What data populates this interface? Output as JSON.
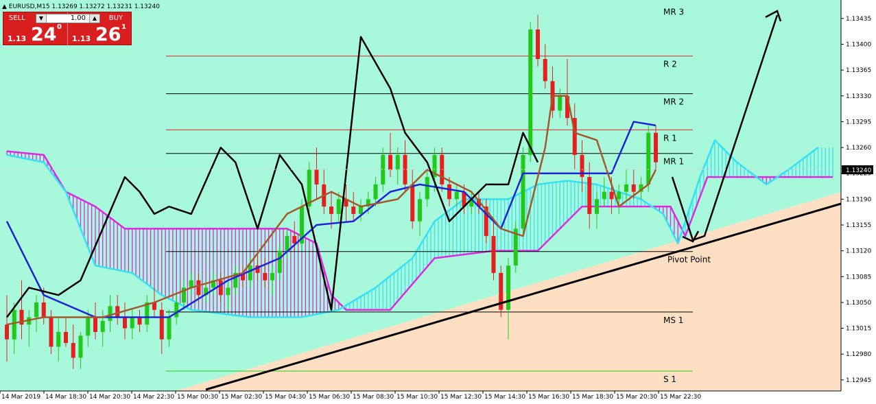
{
  "header": {
    "symbol_info": "▲ EURUSD,M15  1.13269 1.13272 1.13231 1.13240"
  },
  "trade_panel": {
    "sell_label": "SELL",
    "buy_label": "BUY",
    "lot_value": "1.00",
    "sell_price_prefix": "1.13",
    "sell_price_big": "24",
    "sell_price_sup": "0",
    "buy_price_prefix": "1.13",
    "buy_price_big": "26",
    "buy_price_sup": "1"
  },
  "colors": {
    "background_upper": "#a8f9dc",
    "background_lower": "#fde0c3",
    "bull_candle": "#22c81a",
    "bear_candle": "#e61e1e",
    "tenkan": "#1f22d8",
    "kijun": "#a5572c",
    "chikou": "#000000",
    "span_a": "#e026e0",
    "span_b": "#35e0f5",
    "pivot_red": "#e61e1e",
    "pivot_black": "#000000",
    "pivot_green": "#22c81a"
  },
  "chart_data": {
    "type": "candlestick",
    "symbol": "EURUSD",
    "timeframe": "M15",
    "ylim": [
      1.1293,
      1.1346
    ],
    "y_ticks": [
      "1.13435",
      "1.13400",
      "1.13365",
      "1.13330",
      "1.13295",
      "1.13260",
      "1.13225",
      "1.13190",
      "1.13155",
      "1.13120",
      "1.13085",
      "1.13050",
      "1.13015",
      "1.12980",
      "1.12945"
    ],
    "x_ticks": [
      "14 Mar 2019",
      "14 Mar 18:30",
      "14 Mar 20:30",
      "14 Mar 22:30",
      "15 Mar 00:30",
      "15 Mar 02:30",
      "15 Mar 04:30",
      "15 Mar 06:30",
      "15 Mar 08:30",
      "15 Mar 10:30",
      "15 Mar 12:30",
      "15 Mar 14:30",
      "15 Mar 16:30",
      "15 Mar 18:30",
      "15 Mar 20:30",
      "15 Mar 22:30"
    ],
    "current_price": "1.13240",
    "levels": [
      {
        "label": "MR 3",
        "value": 1.13455,
        "color": "none"
      },
      {
        "label": "R 2",
        "value": 1.13384,
        "color": "red"
      },
      {
        "label": "MR 2",
        "value": 1.13333,
        "color": "black"
      },
      {
        "label": "R 1",
        "value": 1.13284,
        "color": "red"
      },
      {
        "label": "MR 1",
        "value": 1.13252,
        "color": "black"
      },
      {
        "label": "Pivot Point",
        "value": 1.13119,
        "color": "black"
      },
      {
        "label": "MS 1",
        "value": 1.13037,
        "color": "black"
      },
      {
        "label": "S 1",
        "value": 1.12957,
        "color": "green"
      }
    ],
    "candles": [
      {
        "o": 1.1302,
        "h": 1.1306,
        "l": 1.1297,
        "c": 1.13
      },
      {
        "o": 1.13,
        "h": 1.1305,
        "l": 1.1298,
        "c": 1.1304
      },
      {
        "o": 1.1304,
        "h": 1.1308,
        "l": 1.13,
        "c": 1.1302
      },
      {
        "o": 1.1302,
        "h": 1.1304,
        "l": 1.1299,
        "c": 1.1303
      },
      {
        "o": 1.1303,
        "h": 1.1306,
        "l": 1.1301,
        "c": 1.1305
      },
      {
        "o": 1.1305,
        "h": 1.1307,
        "l": 1.1302,
        "c": 1.1303
      },
      {
        "o": 1.1303,
        "h": 1.1304,
        "l": 1.1298,
        "c": 1.1299
      },
      {
        "o": 1.1299,
        "h": 1.1303,
        "l": 1.1297,
        "c": 1.1301
      },
      {
        "o": 1.1301,
        "h": 1.1303,
        "l": 1.1299,
        "c": 1.12995
      },
      {
        "o": 1.12995,
        "h": 1.1302,
        "l": 1.1296,
        "c": 1.12975
      },
      {
        "o": 1.12975,
        "h": 1.1301,
        "l": 1.1296,
        "c": 1.13005
      },
      {
        "o": 1.13005,
        "h": 1.1304,
        "l": 1.1299,
        "c": 1.1303
      },
      {
        "o": 1.1303,
        "h": 1.1305,
        "l": 1.13,
        "c": 1.1301
      },
      {
        "o": 1.1301,
        "h": 1.1304,
        "l": 1.1299,
        "c": 1.13025
      },
      {
        "o": 1.13025,
        "h": 1.1306,
        "l": 1.1301,
        "c": 1.13045
      },
      {
        "o": 1.13045,
        "h": 1.1306,
        "l": 1.1302,
        "c": 1.1303
      },
      {
        "o": 1.1303,
        "h": 1.1305,
        "l": 1.13,
        "c": 1.13015
      },
      {
        "o": 1.13015,
        "h": 1.1304,
        "l": 1.13,
        "c": 1.1303
      },
      {
        "o": 1.1303,
        "h": 1.1304,
        "l": 1.1301,
        "c": 1.1302
      },
      {
        "o": 1.1302,
        "h": 1.1306,
        "l": 1.1301,
        "c": 1.1305
      },
      {
        "o": 1.1305,
        "h": 1.1307,
        "l": 1.1303,
        "c": 1.1304
      },
      {
        "o": 1.1304,
        "h": 1.1305,
        "l": 1.1298,
        "c": 1.13
      },
      {
        "o": 1.13,
        "h": 1.1304,
        "l": 1.1299,
        "c": 1.1303
      },
      {
        "o": 1.1303,
        "h": 1.1306,
        "l": 1.1302,
        "c": 1.1305
      },
      {
        "o": 1.1305,
        "h": 1.1308,
        "l": 1.1304,
        "c": 1.1307
      },
      {
        "o": 1.1307,
        "h": 1.1309,
        "l": 1.1306,
        "c": 1.1308
      },
      {
        "o": 1.1308,
        "h": 1.1309,
        "l": 1.1305,
        "c": 1.1306
      },
      {
        "o": 1.1306,
        "h": 1.1308,
        "l": 1.1305,
        "c": 1.1307
      },
      {
        "o": 1.1307,
        "h": 1.1309,
        "l": 1.1306,
        "c": 1.1308
      },
      {
        "o": 1.1308,
        "h": 1.1309,
        "l": 1.1305,
        "c": 1.1306
      },
      {
        "o": 1.1306,
        "h": 1.1308,
        "l": 1.1304,
        "c": 1.1307
      },
      {
        "o": 1.1307,
        "h": 1.131,
        "l": 1.1306,
        "c": 1.1309
      },
      {
        "o": 1.1309,
        "h": 1.131,
        "l": 1.1307,
        "c": 1.1308
      },
      {
        "o": 1.1308,
        "h": 1.1311,
        "l": 1.1307,
        "c": 1.131
      },
      {
        "o": 1.131,
        "h": 1.1312,
        "l": 1.1308,
        "c": 1.1309
      },
      {
        "o": 1.1309,
        "h": 1.1311,
        "l": 1.1307,
        "c": 1.1308
      },
      {
        "o": 1.1308,
        "h": 1.131,
        "l": 1.1306,
        "c": 1.1309
      },
      {
        "o": 1.1309,
        "h": 1.1313,
        "l": 1.1308,
        "c": 1.1312
      },
      {
        "o": 1.1312,
        "h": 1.1315,
        "l": 1.1311,
        "c": 1.1314
      },
      {
        "o": 1.1314,
        "h": 1.1316,
        "l": 1.1312,
        "c": 1.1313
      },
      {
        "o": 1.1313,
        "h": 1.1319,
        "l": 1.1312,
        "c": 1.1318
      },
      {
        "o": 1.1318,
        "h": 1.1324,
        "l": 1.1317,
        "c": 1.1323
      },
      {
        "o": 1.1323,
        "h": 1.1326,
        "l": 1.1319,
        "c": 1.1321
      },
      {
        "o": 1.1321,
        "h": 1.1323,
        "l": 1.1317,
        "c": 1.1318
      },
      {
        "o": 1.1318,
        "h": 1.132,
        "l": 1.1315,
        "c": 1.1317
      },
      {
        "o": 1.1317,
        "h": 1.132,
        "l": 1.1316,
        "c": 1.1319
      },
      {
        "o": 1.1319,
        "h": 1.1321,
        "l": 1.1316,
        "c": 1.1318
      },
      {
        "o": 1.1318,
        "h": 1.132,
        "l": 1.1316,
        "c": 1.1317
      },
      {
        "o": 1.1317,
        "h": 1.1319,
        "l": 1.1316,
        "c": 1.1318
      },
      {
        "o": 1.1318,
        "h": 1.132,
        "l": 1.1317,
        "c": 1.1319
      },
      {
        "o": 1.1319,
        "h": 1.1322,
        "l": 1.1318,
        "c": 1.1321
      },
      {
        "o": 1.1321,
        "h": 1.1326,
        "l": 1.132,
        "c": 1.1325
      },
      {
        "o": 1.1325,
        "h": 1.1328,
        "l": 1.1322,
        "c": 1.1323
      },
      {
        "o": 1.1323,
        "h": 1.1326,
        "l": 1.1321,
        "c": 1.1325
      },
      {
        "o": 1.1325,
        "h": 1.1327,
        "l": 1.132,
        "c": 1.1321
      },
      {
        "o": 1.1321,
        "h": 1.1323,
        "l": 1.1315,
        "c": 1.1316
      },
      {
        "o": 1.1316,
        "h": 1.132,
        "l": 1.1314,
        "c": 1.1319
      },
      {
        "o": 1.1319,
        "h": 1.1323,
        "l": 1.1318,
        "c": 1.1322
      },
      {
        "o": 1.1322,
        "h": 1.1326,
        "l": 1.132,
        "c": 1.1325
      },
      {
        "o": 1.1325,
        "h": 1.1326,
        "l": 1.132,
        "c": 1.1321
      },
      {
        "o": 1.1321,
        "h": 1.1322,
        "l": 1.1318,
        "c": 1.1319
      },
      {
        "o": 1.1319,
        "h": 1.1321,
        "l": 1.1318,
        "c": 1.132
      },
      {
        "o": 1.132,
        "h": 1.1321,
        "l": 1.1317,
        "c": 1.1318
      },
      {
        "o": 1.1318,
        "h": 1.132,
        "l": 1.1317,
        "c": 1.1319
      },
      {
        "o": 1.1319,
        "h": 1.132,
        "l": 1.1317,
        "c": 1.1318
      },
      {
        "o": 1.1318,
        "h": 1.1319,
        "l": 1.1313,
        "c": 1.1314
      },
      {
        "o": 1.1314,
        "h": 1.1316,
        "l": 1.1308,
        "c": 1.1309
      },
      {
        "o": 1.1309,
        "h": 1.131,
        "l": 1.1303,
        "c": 1.1304
      },
      {
        "o": 1.1304,
        "h": 1.1311,
        "l": 1.13,
        "c": 1.131
      },
      {
        "o": 1.131,
        "h": 1.1316,
        "l": 1.1309,
        "c": 1.1315
      },
      {
        "o": 1.1315,
        "h": 1.1326,
        "l": 1.1314,
        "c": 1.1325
      },
      {
        "o": 1.1325,
        "h": 1.1343,
        "l": 1.1324,
        "c": 1.1342
      },
      {
        "o": 1.1342,
        "h": 1.1344,
        "l": 1.1337,
        "c": 1.1338
      },
      {
        "o": 1.1338,
        "h": 1.134,
        "l": 1.1334,
        "c": 1.1335
      },
      {
        "o": 1.1335,
        "h": 1.1337,
        "l": 1.133,
        "c": 1.1331
      },
      {
        "o": 1.1331,
        "h": 1.1334,
        "l": 1.133,
        "c": 1.1333
      },
      {
        "o": 1.1333,
        "h": 1.1338,
        "l": 1.1329,
        "c": 1.133
      },
      {
        "o": 1.133,
        "h": 1.1332,
        "l": 1.1323,
        "c": 1.1325
      },
      {
        "o": 1.1325,
        "h": 1.1327,
        "l": 1.132,
        "c": 1.1322
      },
      {
        "o": 1.1322,
        "h": 1.1324,
        "l": 1.1315,
        "c": 1.1317
      },
      {
        "o": 1.1317,
        "h": 1.132,
        "l": 1.1315,
        "c": 1.1319
      },
      {
        "o": 1.1319,
        "h": 1.1322,
        "l": 1.1318,
        "c": 1.132
      },
      {
        "o": 1.132,
        "h": 1.1322,
        "l": 1.1317,
        "c": 1.1319
      },
      {
        "o": 1.1319,
        "h": 1.1321,
        "l": 1.1317,
        "c": 1.132
      },
      {
        "o": 1.132,
        "h": 1.1323,
        "l": 1.1319,
        "c": 1.1321
      },
      {
        "o": 1.1321,
        "h": 1.1323,
        "l": 1.1319,
        "c": 1.132
      },
      {
        "o": 1.132,
        "h": 1.1322,
        "l": 1.1319,
        "c": 1.1321
      },
      {
        "o": 1.1321,
        "h": 1.1329,
        "l": 1.132,
        "c": 1.1328
      },
      {
        "o": 1.1328,
        "h": 1.1329,
        "l": 1.1323,
        "c": 1.1324
      }
    ],
    "tenkan": [
      [
        0,
        1.1316
      ],
      [
        5,
        1.1306
      ],
      [
        12,
        1.1303
      ],
      [
        22,
        1.1303
      ],
      [
        30,
        1.1308
      ],
      [
        37,
        1.1311
      ],
      [
        42,
        1.13155
      ],
      [
        47,
        1.1316
      ],
      [
        52,
        1.132
      ],
      [
        56,
        1.1321
      ],
      [
        62,
        1.132
      ],
      [
        67,
        1.1315
      ],
      [
        70,
        1.13225
      ],
      [
        82,
        1.13225
      ],
      [
        85,
        1.13295
      ],
      [
        88,
        1.1329
      ]
    ],
    "kijun": [
      [
        0,
        1.1302
      ],
      [
        5,
        1.1303
      ],
      [
        13,
        1.1303
      ],
      [
        20,
        1.1305
      ],
      [
        25,
        1.1307
      ],
      [
        32,
        1.1309
      ],
      [
        38,
        1.1317
      ],
      [
        44,
        1.132
      ],
      [
        48,
        1.1318
      ],
      [
        53,
        1.1319
      ],
      [
        57,
        1.1323
      ],
      [
        63,
        1.132
      ],
      [
        67,
        1.1315
      ],
      [
        70,
        1.1314
      ],
      [
        73,
        1.1326
      ],
      [
        74,
        1.1333
      ],
      [
        76,
        1.1333
      ],
      [
        77,
        1.1328
      ],
      [
        80,
        1.1327
      ],
      [
        83,
        1.1318
      ],
      [
        87,
        1.1321
      ],
      [
        88,
        1.1323
      ]
    ],
    "chikou": [
      [
        0,
        1.1303
      ],
      [
        3,
        1.1307
      ],
      [
        7,
        1.1306
      ],
      [
        10,
        1.1308
      ],
      [
        16,
        1.1322
      ],
      [
        18,
        1.132
      ],
      [
        20,
        1.1317
      ],
      [
        22,
        1.1318
      ],
      [
        25,
        1.1317
      ],
      [
        29,
        1.1326
      ],
      [
        31,
        1.1324
      ],
      [
        34,
        1.1315
      ],
      [
        37,
        1.1325
      ],
      [
        40,
        1.1321
      ],
      [
        44,
        1.1304
      ],
      [
        48,
        1.1341
      ],
      [
        52,
        1.1334
      ],
      [
        54,
        1.1328
      ],
      [
        57,
        1.1324
      ],
      [
        60,
        1.1316
      ],
      [
        63,
        1.1319
      ],
      [
        65,
        1.1321
      ],
      [
        68,
        1.1321
      ],
      [
        70,
        1.1328
      ],
      [
        72,
        1.1324
      ]
    ],
    "span_a": [
      [
        0,
        1.13255
      ],
      [
        5,
        1.1325
      ],
      [
        8,
        1.132
      ],
      [
        12,
        1.1318
      ],
      [
        16,
        1.1315
      ],
      [
        20,
        1.1315
      ],
      [
        28,
        1.1315
      ],
      [
        38,
        1.1315
      ],
      [
        42,
        1.1313
      ],
      [
        44,
        1.1306
      ],
      [
        46,
        1.1304
      ],
      [
        52,
        1.1304
      ],
      [
        58,
        1.1311
      ],
      [
        66,
        1.1312
      ],
      [
        72,
        1.1312
      ],
      [
        78,
        1.1318
      ],
      [
        90,
        1.1318
      ],
      [
        92,
        1.1314
      ],
      [
        95,
        1.1322
      ],
      [
        112,
        1.1322
      ]
    ],
    "span_b": [
      [
        0,
        1.1325
      ],
      [
        5,
        1.1324
      ],
      [
        8,
        1.132
      ],
      [
        12,
        1.131
      ],
      [
        17,
        1.1309
      ],
      [
        21,
        1.1306
      ],
      [
        25,
        1.1304
      ],
      [
        33,
        1.1303
      ],
      [
        40,
        1.1303
      ],
      [
        45,
        1.1304
      ],
      [
        50,
        1.1307
      ],
      [
        55,
        1.1311
      ],
      [
        58,
        1.1316
      ],
      [
        62,
        1.1319
      ],
      [
        68,
        1.1319
      ],
      [
        72,
        1.1321
      ],
      [
        76,
        1.13215
      ],
      [
        80,
        1.1321
      ],
      [
        86,
        1.1319
      ],
      [
        89,
        1.1317
      ],
      [
        91,
        1.1313
      ],
      [
        94,
        1.1322
      ],
      [
        96,
        1.1327
      ],
      [
        99,
        1.1324
      ],
      [
        103,
        1.1321
      ],
      [
        106,
        1.1323
      ],
      [
        110,
        1.1326
      ]
    ]
  }
}
